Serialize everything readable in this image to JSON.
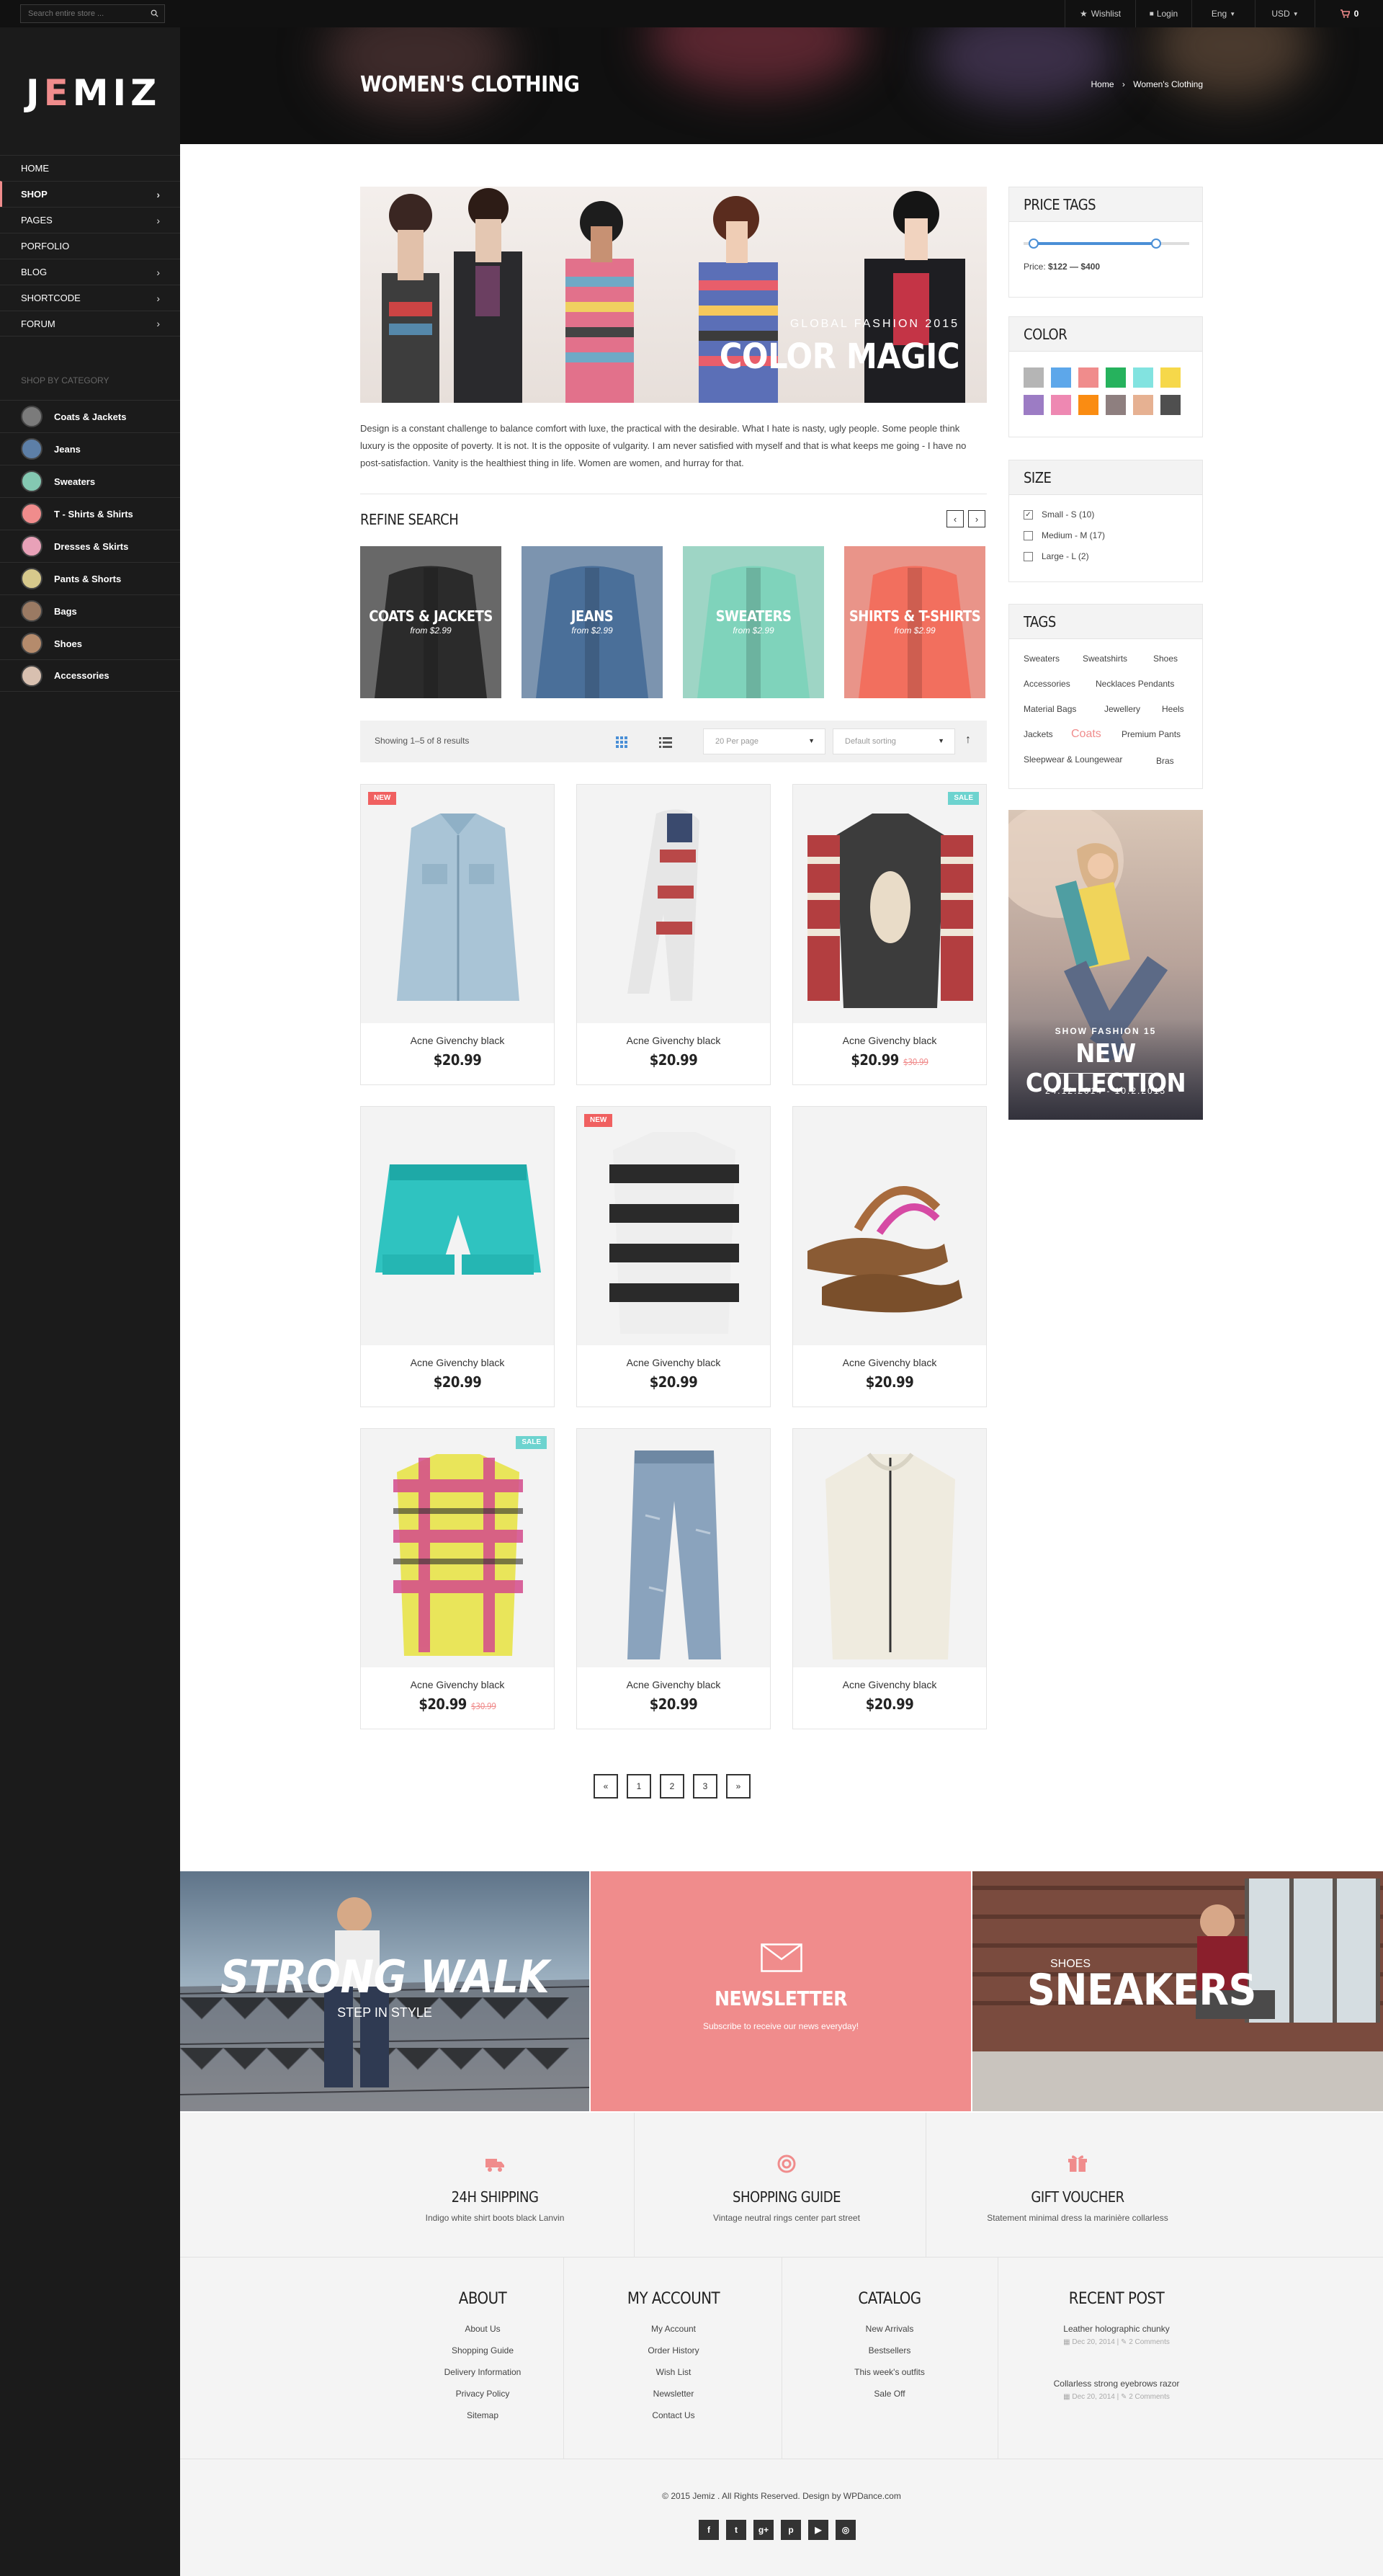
{
  "topbar": {
    "search_placeholder": "Search entire store ...",
    "wishlist": "Wishlist",
    "login": "Login",
    "language": "Eng",
    "currency": "USD",
    "cart_count": "0"
  },
  "sidebar": {
    "logo": "JEMIZ",
    "nav": [
      {
        "label": "HOME",
        "has_children": false,
        "active": false
      },
      {
        "label": "SHOP",
        "has_children": true,
        "active": true
      },
      {
        "label": "PAGES",
        "has_children": true,
        "active": false
      },
      {
        "label": "PORFOLIO",
        "has_children": false,
        "active": false
      },
      {
        "label": "BLOG",
        "has_children": true,
        "active": false
      },
      {
        "label": "SHORTCODE",
        "has_children": true,
        "active": false
      },
      {
        "label": "FORUM",
        "has_children": true,
        "active": false
      }
    ],
    "shop_by_category": "SHOP BY CATEGORY",
    "categories": [
      {
        "label": "Coats & Jackets",
        "color": "#7b7b7b"
      },
      {
        "label": "Jeans",
        "color": "#5d7fa7"
      },
      {
        "label": "Sweaters",
        "color": "#84c8b2"
      },
      {
        "label": "T - Shirts & Shirts",
        "color": "#f08c8c"
      },
      {
        "label": "Dresses & Skirts",
        "color": "#e8a1b8"
      },
      {
        "label": "Pants & Shorts",
        "color": "#d7c98c"
      },
      {
        "label": "Bags",
        "color": "#9a7a63"
      },
      {
        "label": "Shoes",
        "color": "#b58b6c"
      },
      {
        "label": "Accessories",
        "color": "#d8c0b0"
      }
    ]
  },
  "header": {
    "title": "WOMEN'S CLOTHING",
    "breadcrumb_home": "Home",
    "breadcrumb_sep": "›",
    "breadcrumb_current": "Women's Clothing"
  },
  "banner": {
    "subtitle": "GLOBAL FASHION 2015",
    "title": "COLOR MAGIC"
  },
  "intro": "Design is a constant challenge to balance comfort with luxe, the practical with the desirable. What I hate is nasty, ugly people. Some people think luxury is the opposite of poverty. It is not. It is the opposite of vulgarity. I am never satisfied with myself and that is what keeps me going - I have no post-satisfaction. Vanity is the healthiest thing in life. Women are women, and hurray for that.",
  "refine": {
    "title": "REFINE SEARCH",
    "prev": "‹",
    "next": "›",
    "cards": [
      {
        "label": "COATS & JACKETS",
        "from": "from $2.99",
        "color": "#2b2b2b"
      },
      {
        "label": "JEANS",
        "from": "from $2.99",
        "color": "#4a6f99"
      },
      {
        "label": "SWEATERS",
        "from": "from $2.99",
        "color": "#7fd3bb"
      },
      {
        "label": "SHIRTS & T-SHIRTS",
        "from": "from $2.99",
        "color": "#f26f5e"
      }
    ]
  },
  "toolbar": {
    "showing": "Showing 1–5 of 8 results",
    "per_page": "20 Per page",
    "sorting": "Default sorting",
    "sort_dir": "↑"
  },
  "products": [
    {
      "name": "Acne Givenchy black",
      "price": "$20.99",
      "old_price": "",
      "badge": "NEW",
      "badge_color": "#f06060",
      "kind": "shirt",
      "color": "#a9c4d6"
    },
    {
      "name": "Acne Givenchy black",
      "price": "$20.99",
      "old_price": "",
      "badge": "",
      "badge_color": "",
      "kind": "scarf",
      "color": "#b94848"
    },
    {
      "name": "Acne Givenchy black",
      "price": "$20.99",
      "old_price": "$30.99",
      "badge": "SALE",
      "badge_color": "#6dd3cf",
      "kind": "sweater",
      "color": "#3c3c3c"
    },
    {
      "name": "Acne Givenchy black",
      "price": "$20.99",
      "old_price": "",
      "badge": "",
      "badge_color": "",
      "kind": "shorts",
      "color": "#2fc3c0"
    },
    {
      "name": "Acne Givenchy black",
      "price": "$20.99",
      "old_price": "",
      "badge": "NEW",
      "badge_color": "#f06060",
      "kind": "stripe",
      "color": "#2a2a2a"
    },
    {
      "name": "Acne Givenchy black",
      "price": "$20.99",
      "old_price": "",
      "badge": "",
      "badge_color": "",
      "kind": "sandal",
      "color": "#a86b3d"
    },
    {
      "name": "Acne Givenchy black",
      "price": "$20.99",
      "old_price": "$30.99",
      "badge": "SALE",
      "badge_color": "#6dd3cf",
      "kind": "plaid",
      "color": "#d44b8c"
    },
    {
      "name": "Acne Givenchy black",
      "price": "$20.99",
      "old_price": "",
      "badge": "",
      "badge_color": "",
      "kind": "jeans",
      "color": "#8aa3bd"
    },
    {
      "name": "Acne Givenchy black",
      "price": "$20.99",
      "old_price": "",
      "badge": "",
      "badge_color": "",
      "kind": "jacket",
      "color": "#efebdf"
    }
  ],
  "pagination": [
    "«",
    "1",
    "2",
    "3",
    "»"
  ],
  "widgets": {
    "price_title": "PRICE TAGS",
    "price_label": "Price:",
    "price_range": "$122 — $400",
    "price_low_fraction": 0.06,
    "price_high_fraction": 0.8,
    "color_title": "COLOR",
    "colors": [
      "#b5b5b5",
      "#5da7ea",
      "#f08c8c",
      "#26b25d",
      "#82e3e0",
      "#f6d84a",
      "#9c7cc4",
      "#ee88b2",
      "#fa8c12",
      "#8e7f7f",
      "#e6b192",
      "#4f4f4f"
    ],
    "size_title": "SIZE",
    "sizes": [
      {
        "label": "Small - S (10)",
        "checked": true
      },
      {
        "label": "Medium - M (17)",
        "checked": false
      },
      {
        "label": "Large - L (2)",
        "checked": false
      }
    ],
    "tags_title": "TAGS",
    "tags": [
      "Sweaters",
      "Sweatshirts",
      "Shoes",
      "Accessories",
      "Necklaces Pendants",
      "Material Bags",
      "Jewellery",
      "Heels",
      "Jackets",
      "Coats",
      "Premium Pants",
      "Sleepwear & Loungewear",
      "Bras"
    ],
    "promo_small": "SHOW FASHION 15",
    "promo_title": "NEW COLLECTION",
    "promo_dates": "24.12.2014 - 10.2.2015"
  },
  "tiles": {
    "walk_title": "STRONG WALK",
    "walk_sub": "STEP IN STYLE",
    "newsletter_title": "NEWSLETTER",
    "newsletter_sub": "Subscribe to receive our news everyday!",
    "shoes_small": "SHOES",
    "shoes_title": "SNEAKERS"
  },
  "features": [
    {
      "title": "24H SHIPPING",
      "desc": "Indigo white shirt boots black Lanvin",
      "icon": "truck-icon"
    },
    {
      "title": "SHOPPING GUIDE",
      "desc": "Vintage neutral rings center part street",
      "icon": "lifebuoy-icon"
    },
    {
      "title": "GIFT VOUCHER",
      "desc": "Statement minimal dress la marinière collarless",
      "icon": "gift-icon"
    }
  ],
  "footer": {
    "about_title": "ABOUT",
    "about_links": [
      "About Us",
      "Shopping Guide",
      "Delivery Information",
      "Privacy Policy",
      "Sitemap"
    ],
    "account_title": "MY ACCOUNT",
    "account_links": [
      "My Account",
      "Order History",
      "Wish List",
      "Newsletter",
      "Contact Us"
    ],
    "catalog_title": "CATALOG",
    "catalog_links": [
      "New Arrivals",
      "Bestsellers",
      "This week's outfits",
      "Sale Off"
    ],
    "recent_title": "RECENT POST",
    "posts": [
      {
        "title": "Leather holographic chunky",
        "date": "Dec 20, 2014",
        "comments": "2 Comments"
      },
      {
        "title": "Collarless strong eyebrows razor",
        "date": "Dec 20, 2014",
        "comments": "2 Comments"
      }
    ],
    "copyright": "© 2015 Jemiz . All Rights Reserved. Design by WPDance.com",
    "social": [
      "facebook-icon",
      "twitter-icon",
      "google-plus-icon",
      "pinterest-icon",
      "youtube-icon",
      "instagram-icon"
    ]
  }
}
